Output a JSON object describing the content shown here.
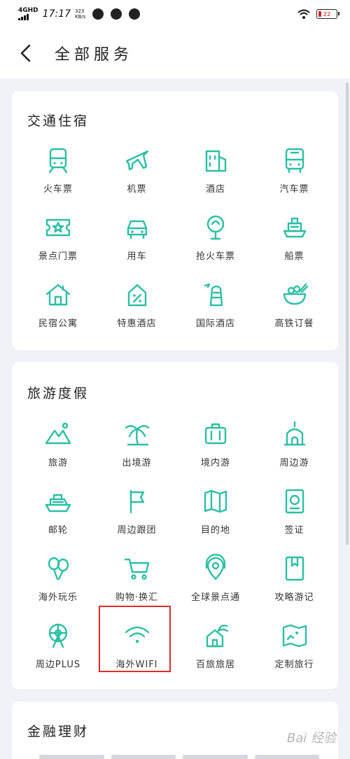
{
  "status_bar": {
    "network": "4GHD",
    "time": "17:17",
    "speed_value": "323",
    "speed_unit": "KB/s",
    "battery": "22"
  },
  "header": {
    "title": "全部服务"
  },
  "colors": {
    "accent": "#2bbfa4",
    "highlight": "#e02b2b"
  },
  "sections": [
    {
      "title": "交通住宿",
      "items": [
        {
          "label": "火车票",
          "icon": "train-icon"
        },
        {
          "label": "机票",
          "icon": "plane-icon"
        },
        {
          "label": "酒店",
          "icon": "hotel-icon"
        },
        {
          "label": "汽车票",
          "icon": "bus-icon"
        },
        {
          "label": "景点门票",
          "icon": "ticket-icon"
        },
        {
          "label": "用车",
          "icon": "car-icon"
        },
        {
          "label": "抢火车票",
          "icon": "grab-ticket-icon"
        },
        {
          "label": "船票",
          "icon": "ship-icon"
        },
        {
          "label": "民宿公寓",
          "icon": "house-icon"
        },
        {
          "label": "特惠酒店",
          "icon": "discount-hotel-icon"
        },
        {
          "label": "国际酒店",
          "icon": "intl-hotel-icon"
        },
        {
          "label": "高铁订餐",
          "icon": "meal-icon"
        }
      ]
    },
    {
      "title": "旅游度假",
      "items": [
        {
          "label": "旅游",
          "icon": "mountain-icon"
        },
        {
          "label": "出境游",
          "icon": "palm-icon"
        },
        {
          "label": "境内游",
          "icon": "luggage-icon"
        },
        {
          "label": "周边游",
          "icon": "temple-icon"
        },
        {
          "label": "邮轮",
          "icon": "cruise-icon"
        },
        {
          "label": "周边跟团",
          "icon": "flag-icon"
        },
        {
          "label": "目的地",
          "icon": "map-icon"
        },
        {
          "label": "签证",
          "icon": "passport-icon"
        },
        {
          "label": "海外玩乐",
          "icon": "balloon-icon"
        },
        {
          "label": "购物·换汇",
          "icon": "cart-icon"
        },
        {
          "label": "全球景点通",
          "icon": "headset-location-icon"
        },
        {
          "label": "攻略游记",
          "icon": "guidebook-icon"
        },
        {
          "label": "周边PLUS",
          "icon": "ferris-wheel-icon"
        },
        {
          "label": "海外WIFI",
          "icon": "wifi-icon"
        },
        {
          "label": "百旅旅居",
          "icon": "villa-icon"
        },
        {
          "label": "定制旅行",
          "icon": "custom-map-icon"
        }
      ]
    },
    {
      "title": "金融理财",
      "items": []
    }
  ],
  "watermark": "Bai 经验"
}
